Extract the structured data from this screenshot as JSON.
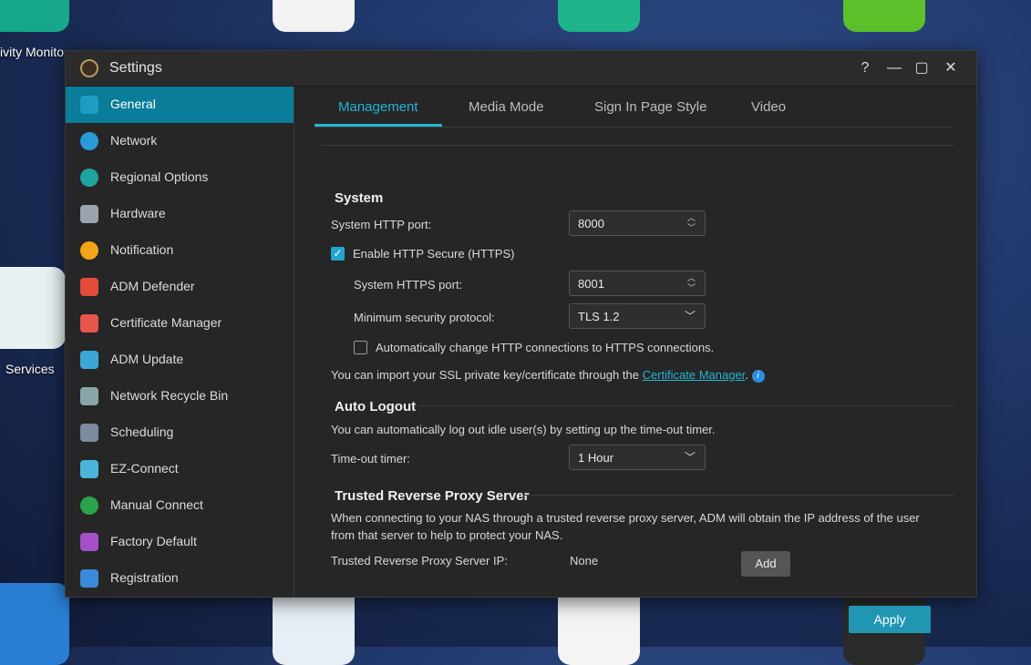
{
  "desktop": {
    "labels": [
      "ivity Monito",
      "Services"
    ]
  },
  "window": {
    "title": "Settings",
    "controls": {
      "help": "?",
      "minimize": "—",
      "maximize": "▢",
      "close": "✕"
    }
  },
  "sidebar": {
    "items": [
      {
        "label": "General",
        "icon": "general-icon",
        "color": "#1e9cc4"
      },
      {
        "label": "Network",
        "icon": "globe-icon",
        "color": "#2a9ad6"
      },
      {
        "label": "Regional Options",
        "icon": "regional-icon",
        "color": "#1fa3a0"
      },
      {
        "label": "Hardware",
        "icon": "hardware-icon",
        "color": "#9aa4b0"
      },
      {
        "label": "Notification",
        "icon": "notification-icon",
        "color": "#f2a516"
      },
      {
        "label": "ADM Defender",
        "icon": "firewall-icon",
        "color": "#e24a3a"
      },
      {
        "label": "Certificate Manager",
        "icon": "certificate-icon",
        "color": "#e6564a"
      },
      {
        "label": "ADM Update",
        "icon": "update-icon",
        "color": "#3aa7d8"
      },
      {
        "label": "Network Recycle Bin",
        "icon": "recycle-bin-icon",
        "color": "#8aa5a8"
      },
      {
        "label": "Scheduling",
        "icon": "calendar-icon",
        "color": "#7d8ba0"
      },
      {
        "label": "EZ-Connect",
        "icon": "cloud-icon",
        "color": "#4bb5d8"
      },
      {
        "label": "Manual Connect",
        "icon": "manual-connect-icon",
        "color": "#2aa34a"
      },
      {
        "label": "Factory Default",
        "icon": "undo-icon",
        "color": "#a450c8"
      },
      {
        "label": "Registration",
        "icon": "registration-icon",
        "color": "#3a8ad8"
      }
    ]
  },
  "tabs": [
    "Management",
    "Media Mode",
    "Sign In Page Style",
    "Video"
  ],
  "system": {
    "title": "System",
    "http_port_label": "System HTTP port:",
    "http_port_value": "8000",
    "https_enable_label": "Enable HTTP Secure (HTTPS)",
    "https_port_label": "System HTTPS port:",
    "https_port_value": "8001",
    "min_protocol_label": "Minimum security protocol:",
    "min_protocol_value": "TLS 1.2",
    "auto_redirect_label": "Automatically change HTTP connections to HTTPS connections.",
    "ssl_note_prefix": "You can import your SSL private key/certificate through the ",
    "ssl_note_link": "Certificate Manager",
    "ssl_note_suffix": "."
  },
  "auto_logout": {
    "title": "Auto Logout",
    "description": "You can automatically log out idle user(s) by setting up the time-out timer.",
    "timer_label": "Time-out timer:",
    "timer_value": "1 Hour"
  },
  "proxy": {
    "title": "Trusted Reverse Proxy Server",
    "description_line1": "When connecting to your NAS through a trusted reverse proxy server, ADM will obtain the IP address of the user",
    "description_line2": "from that server to help to protect your NAS.",
    "ip_label": "Trusted Reverse Proxy Server IP:",
    "ip_value": "None",
    "add_label": "Add"
  },
  "apply_label": "Apply"
}
